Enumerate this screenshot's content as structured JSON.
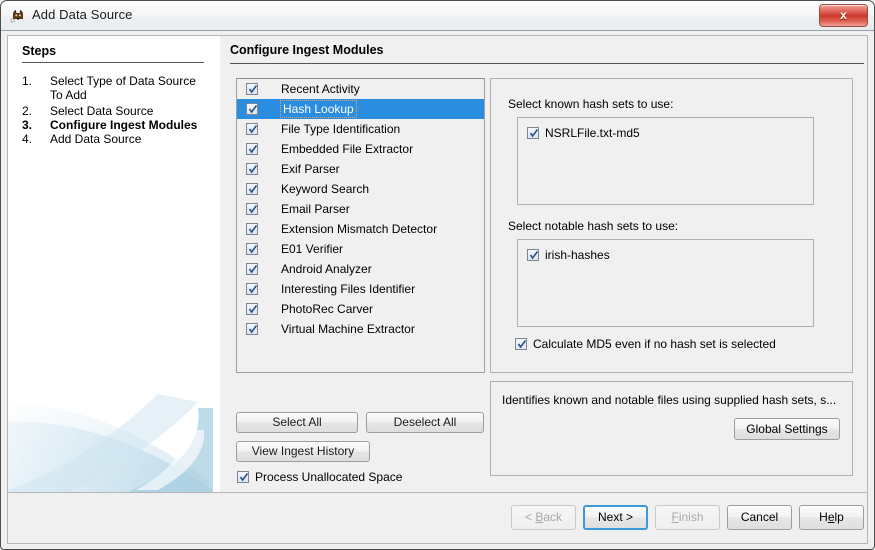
{
  "window": {
    "title": "Add Data Source",
    "icon": "autopsy-logo-icon",
    "close_label": "x"
  },
  "steps": {
    "heading": "Steps",
    "items": [
      {
        "num": "1.",
        "label": "Select Type of Data Source To Add",
        "current": false
      },
      {
        "num": "2.",
        "label": "Select Data Source",
        "current": false
      },
      {
        "num": "3.",
        "label": "Configure Ingest Modules",
        "current": true
      },
      {
        "num": "4.",
        "label": "Add Data Source",
        "current": false
      }
    ]
  },
  "main": {
    "heading": "Configure Ingest Modules",
    "modules": [
      {
        "label": "Recent Activity",
        "checked": true,
        "selected": false
      },
      {
        "label": "Hash Lookup",
        "checked": true,
        "selected": true
      },
      {
        "label": "File Type Identification",
        "checked": true,
        "selected": false
      },
      {
        "label": "Embedded File Extractor",
        "checked": true,
        "selected": false
      },
      {
        "label": "Exif Parser",
        "checked": true,
        "selected": false
      },
      {
        "label": "Keyword Search",
        "checked": true,
        "selected": false
      },
      {
        "label": "Email Parser",
        "checked": true,
        "selected": false
      },
      {
        "label": "Extension Mismatch Detector",
        "checked": true,
        "selected": false
      },
      {
        "label": "E01 Verifier",
        "checked": true,
        "selected": false
      },
      {
        "label": "Android Analyzer",
        "checked": true,
        "selected": false
      },
      {
        "label": "Interesting Files Identifier",
        "checked": true,
        "selected": false
      },
      {
        "label": "PhotoRec Carver",
        "checked": true,
        "selected": false
      },
      {
        "label": "Virtual Machine Extractor",
        "checked": true,
        "selected": false
      }
    ],
    "select_all_label": "Select All",
    "deselect_all_label": "Deselect All",
    "view_history_label": "View Ingest History",
    "process_unallocated": {
      "label": "Process Unallocated Space",
      "checked": true
    }
  },
  "settings": {
    "known_label": "Select known hash sets to use:",
    "known_sets": [
      {
        "label": "NSRLFile.txt-md5",
        "checked": true
      }
    ],
    "notable_label": "Select notable hash sets to use:",
    "notable_sets": [
      {
        "label": "irish-hashes",
        "checked": true
      }
    ],
    "calculate_md5": {
      "label": "Calculate MD5 even if no hash set is selected",
      "checked": true
    }
  },
  "description": {
    "text": "Identifies known and notable files using supplied hash sets, s...",
    "global_settings_label": "Global Settings"
  },
  "navigation": {
    "back": {
      "label": "< Back",
      "enabled": false,
      "default": false
    },
    "next": {
      "label": "Next >",
      "enabled": true,
      "default": true
    },
    "finish": {
      "label": "Finish",
      "enabled": false,
      "default": false
    },
    "cancel": {
      "label": "Cancel",
      "enabled": true,
      "default": false
    },
    "help": {
      "label": "Help",
      "enabled": true,
      "default": false
    }
  },
  "colors": {
    "selection_blue": "#2b8de0",
    "focus_border": "#3c9ad8",
    "close_red": "#cc3a2c",
    "panel_bg": "#f0f0f0",
    "steps_bg": "#ffffff"
  }
}
